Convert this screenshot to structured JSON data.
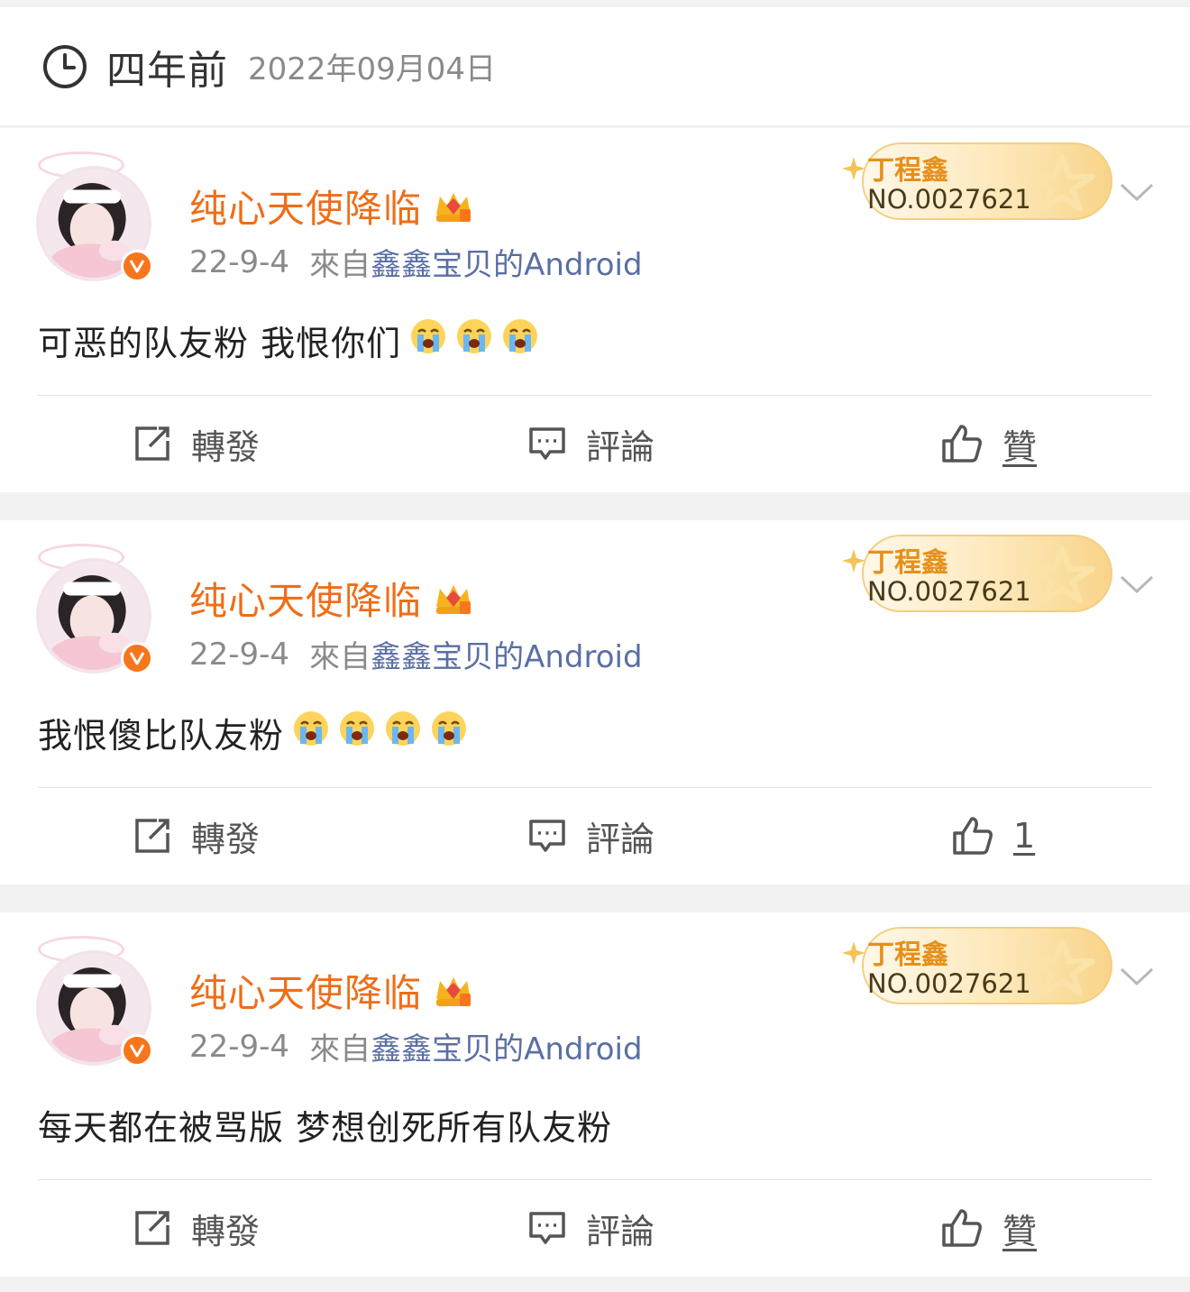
{
  "header": {
    "relative_time": "四年前",
    "absolute_date": "2022年09月04日"
  },
  "colors": {
    "username": "#f06d17",
    "device": "#5a6fa3",
    "verified": "#f7761c"
  },
  "posts": [
    {
      "username": "纯心天使降临",
      "time": "22-9-4",
      "from_label": "來自",
      "device": "鑫鑫宝贝的Android",
      "fan_badge": {
        "name": "丁程鑫",
        "number": "NO.0027621"
      },
      "text": "可恶的队友粉 我恨你们",
      "emoji_count": 3,
      "actions": {
        "repost": "轉發",
        "comment": "評論",
        "like": "贊"
      }
    },
    {
      "username": "纯心天使降临",
      "time": "22-9-4",
      "from_label": "來自",
      "device": "鑫鑫宝贝的Android",
      "fan_badge": {
        "name": "丁程鑫",
        "number": "NO.0027621"
      },
      "text": "我恨傻比队友粉",
      "emoji_count": 4,
      "actions": {
        "repost": "轉發",
        "comment": "評論",
        "like": "1"
      }
    },
    {
      "username": "纯心天使降临",
      "time": "22-9-4",
      "from_label": "來自",
      "device": "鑫鑫宝贝的Android",
      "fan_badge": {
        "name": "丁程鑫",
        "number": "NO.0027621"
      },
      "text": "每天都在被骂版 梦想创死所有队友粉",
      "emoji_count": 0,
      "actions": {
        "repost": "轉發",
        "comment": "評論",
        "like": "贊"
      }
    }
  ]
}
